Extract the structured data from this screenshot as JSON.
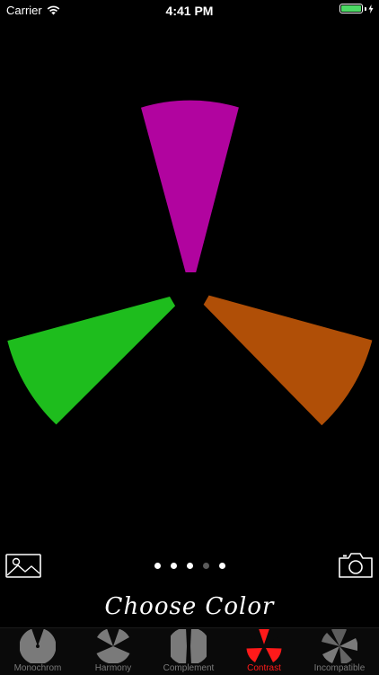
{
  "status": {
    "carrier": "Carrier",
    "time": "4:41 PM",
    "battery_color": "#4cd964"
  },
  "wheel": {
    "segments": [
      {
        "name": "magenta",
        "color": "#b1049f"
      },
      {
        "name": "orange",
        "color": "#b04f07"
      },
      {
        "name": "green",
        "color": "#1ebd1d"
      }
    ]
  },
  "toolbar": {
    "left_icon": "image-icon",
    "right_icon": "camera-icon"
  },
  "pager": {
    "count": 5,
    "active_index": 3,
    "color": "#ffffff",
    "active_color": "#5a5a5a"
  },
  "title": "Choose Color",
  "tabbar": {
    "active_color": "#ff1a1a",
    "inactive_color": "#7a7a7a",
    "tabs": [
      {
        "label": "Monochrom",
        "icon": "monochrom-icon",
        "active": false
      },
      {
        "label": "Harmony",
        "icon": "harmony-icon",
        "active": false
      },
      {
        "label": "Complement",
        "icon": "complement-icon",
        "active": false
      },
      {
        "label": "Contrast",
        "icon": "contrast-icon",
        "active": true
      },
      {
        "label": "Incompatible",
        "icon": "incompatible-icon",
        "active": false
      }
    ]
  }
}
